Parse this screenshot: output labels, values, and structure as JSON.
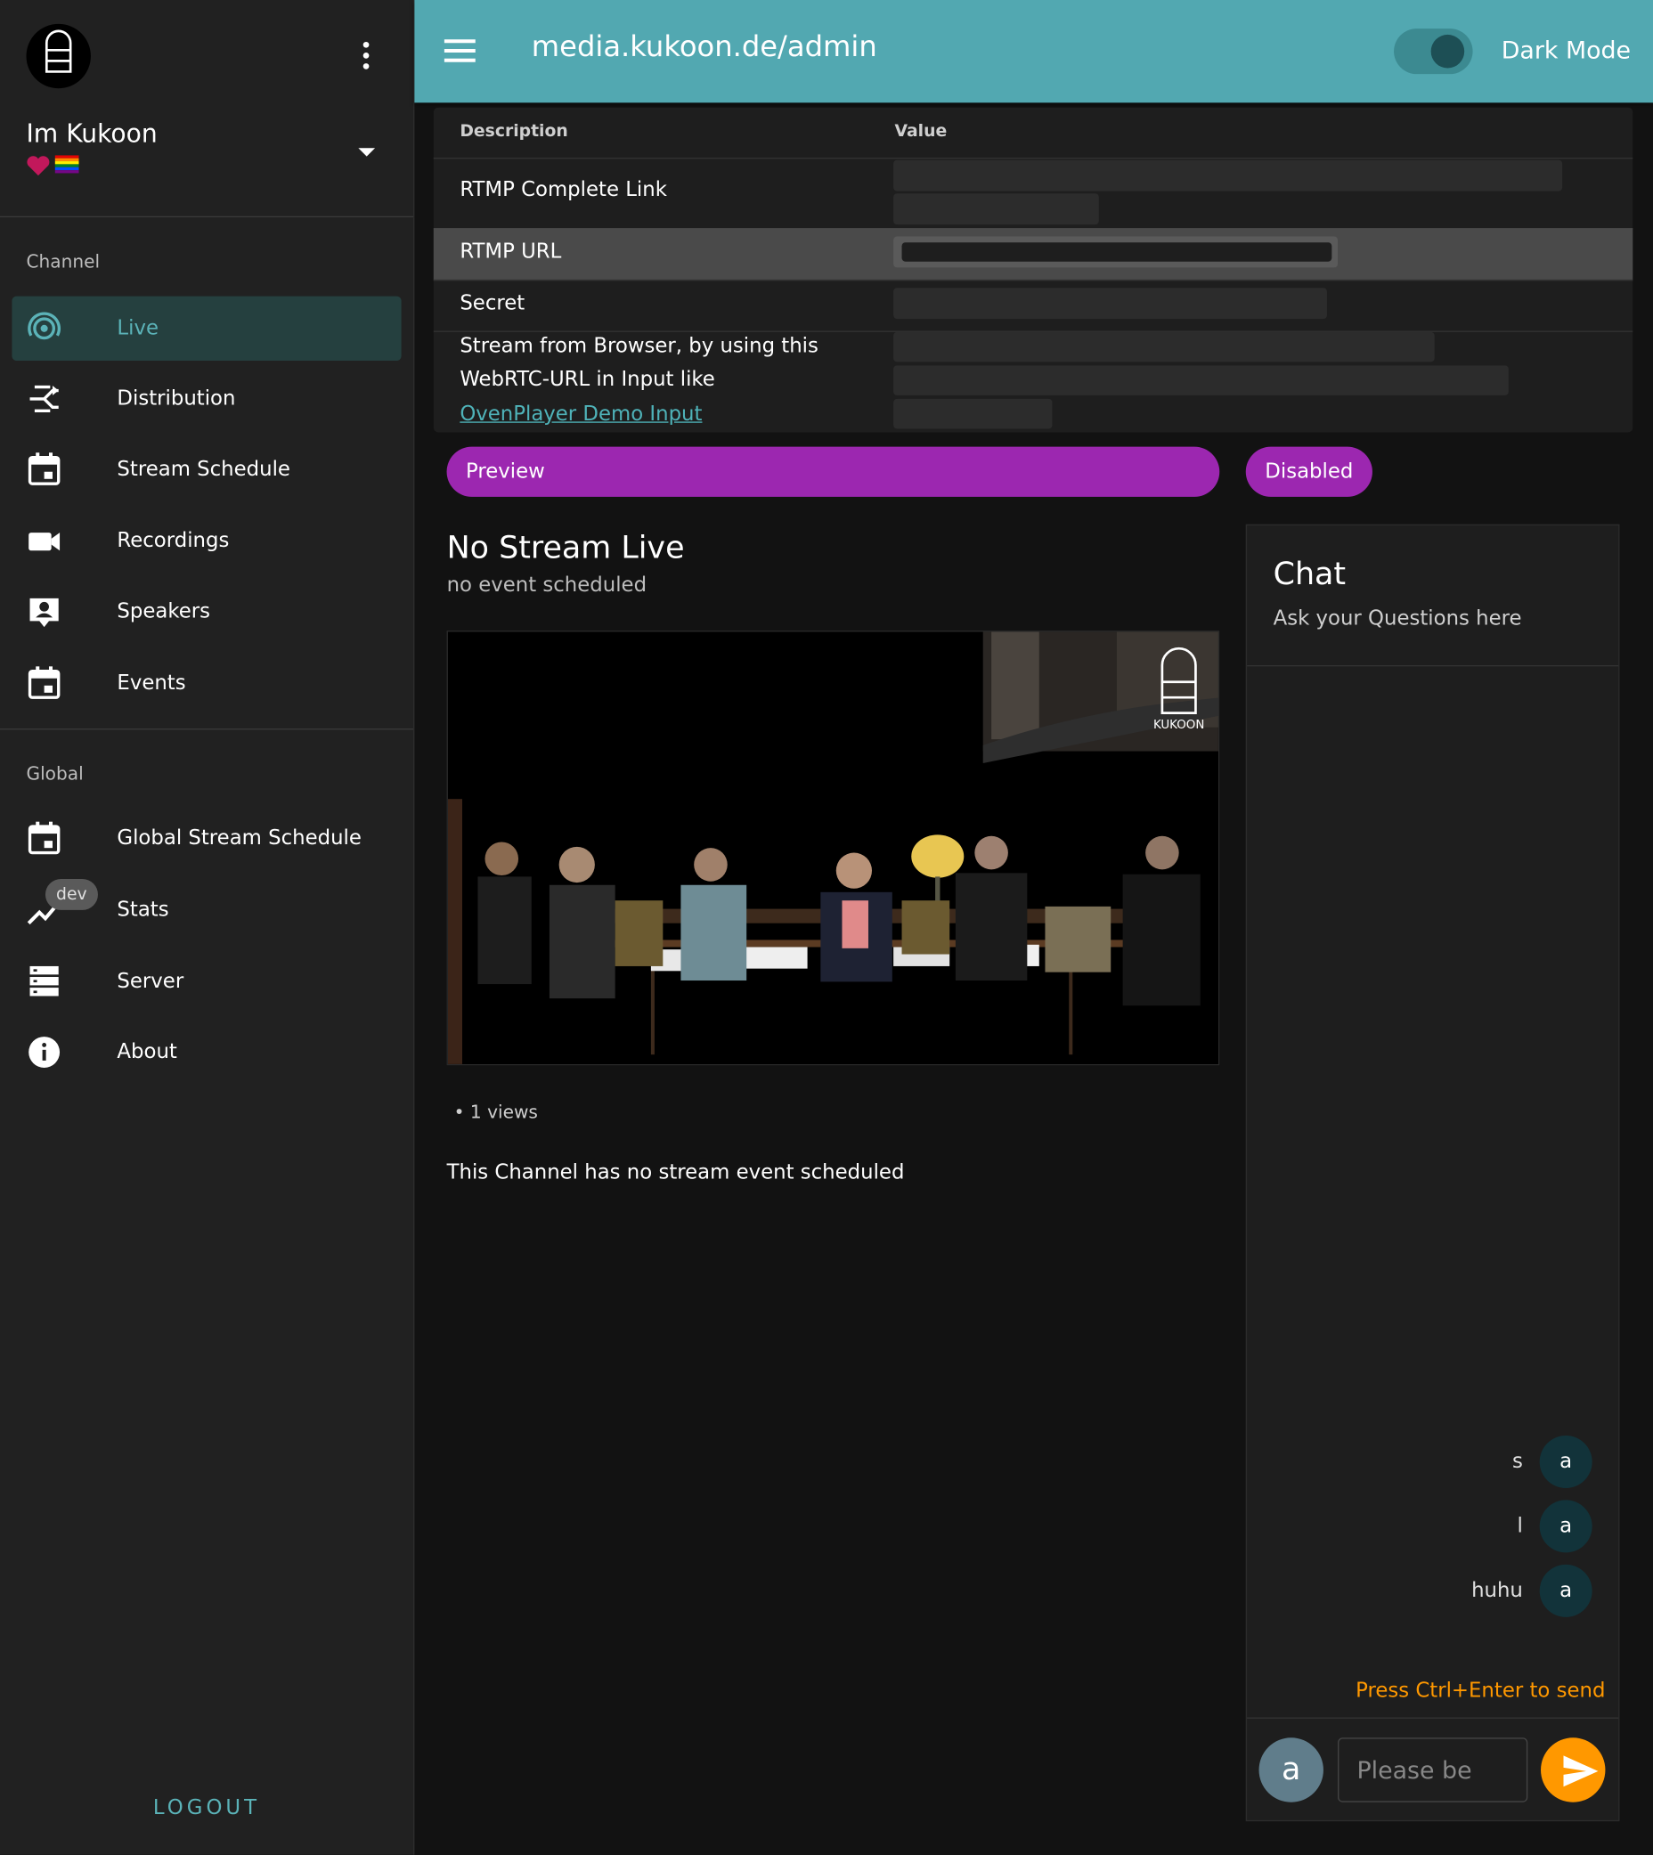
{
  "sidebar": {
    "user_name": "Im Kukoon",
    "channel_label": "Channel",
    "channel_items": [
      {
        "label": "Live",
        "icon": "broadcast-icon"
      },
      {
        "label": "Distribution",
        "icon": "distribution-icon"
      },
      {
        "label": "Stream Schedule",
        "icon": "calendar-icon"
      },
      {
        "label": "Recordings",
        "icon": "video-camera-icon"
      },
      {
        "label": "Speakers",
        "icon": "speaker-icon"
      },
      {
        "label": "Events",
        "icon": "calendar-icon"
      }
    ],
    "global_label": "Global",
    "global_items": [
      {
        "label": "Global Stream Schedule",
        "icon": "calendar-icon"
      },
      {
        "label": "Stats",
        "icon": "chart-line-icon",
        "badge": "dev"
      },
      {
        "label": "Server",
        "icon": "server-icon"
      },
      {
        "label": "About",
        "icon": "info-icon"
      }
    ],
    "logout_label": "LOGOUT"
  },
  "topbar": {
    "title": "media.kukoon.de/admin",
    "dark_mode_label": "Dark Mode"
  },
  "table": {
    "headers": [
      "Description",
      "Value"
    ],
    "rows": [
      {
        "description": "RTMP Complete Link"
      },
      {
        "description": "RTMP URL"
      },
      {
        "description": "Secret"
      },
      {
        "description_line1": "Stream from Browser, by using this",
        "description_line2": "WebRTC-URL in Input like",
        "link": "OvenPlayer Demo Input"
      }
    ]
  },
  "buttons": {
    "preview": "Preview",
    "disabled": "Disabled"
  },
  "stream": {
    "title": "No Stream Live",
    "subtitle": "no event scheduled",
    "views": "• 1 views",
    "no_event": "This Channel has no stream event scheduled",
    "logo_text": "KUKOON"
  },
  "chat": {
    "title": "Chat",
    "subtitle": "Ask your Questions here",
    "messages": [
      {
        "text": "s",
        "avatar": "a"
      },
      {
        "text": "l",
        "avatar": "a"
      },
      {
        "text": "huhu",
        "avatar": "a"
      }
    ],
    "hint": "Press Ctrl+Enter to send",
    "avatar": "a",
    "input_placeholder": "Please be"
  },
  "colors": {
    "accent": "#52a8b1",
    "purple": "#9c27b0",
    "orange": "#ff9800"
  }
}
